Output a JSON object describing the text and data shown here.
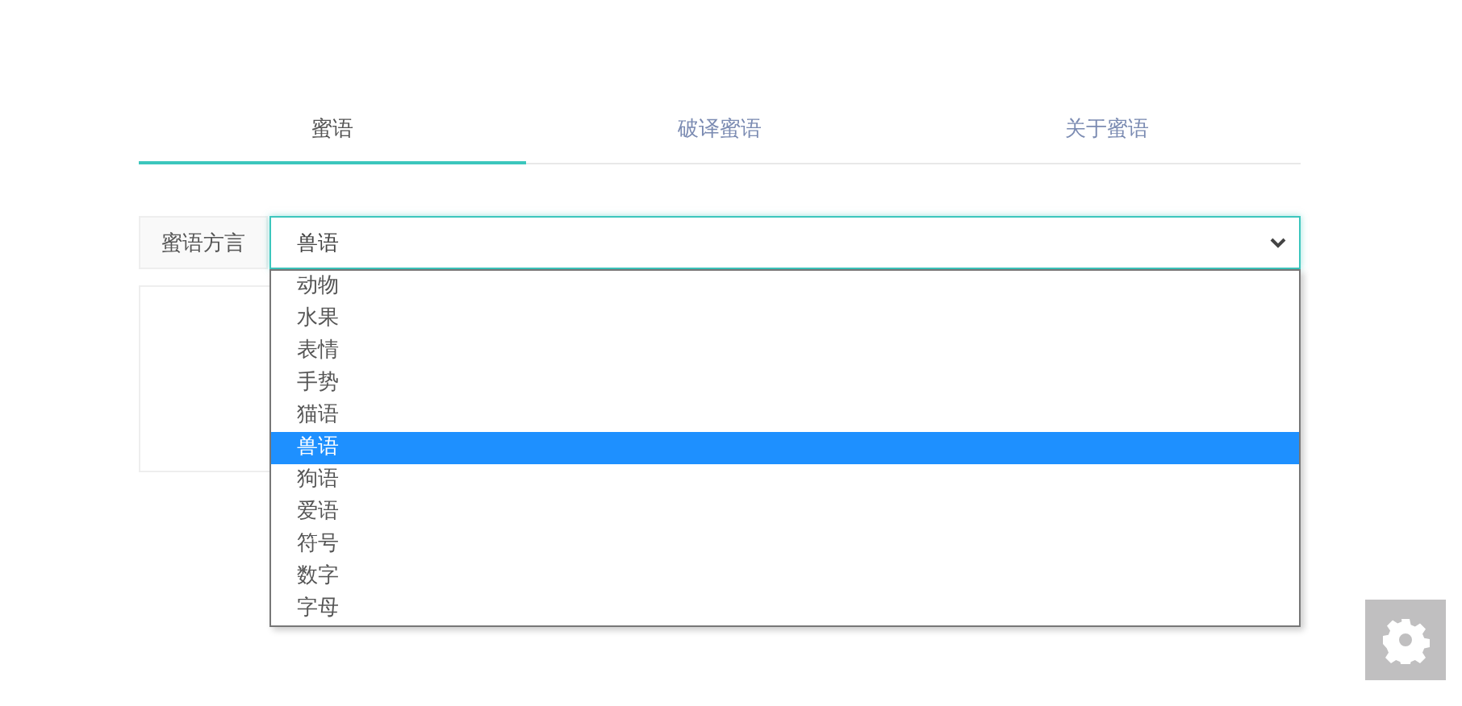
{
  "tabs": [
    {
      "label": "蜜语",
      "selected": true
    },
    {
      "label": "破译蜜语",
      "selected": false
    },
    {
      "label": "关于蜜语",
      "selected": false
    }
  ],
  "dialect": {
    "label": "蜜语方言",
    "value": "兽语",
    "expanded": true,
    "options": [
      {
        "label": "动物",
        "selected": false
      },
      {
        "label": "水果",
        "selected": false
      },
      {
        "label": "表情",
        "selected": false
      },
      {
        "label": "手势",
        "selected": false
      },
      {
        "label": "猫语",
        "selected": false
      },
      {
        "label": "兽语",
        "selected": true
      },
      {
        "label": "狗语",
        "selected": false
      },
      {
        "label": "爱语",
        "selected": false
      },
      {
        "label": "符号",
        "selected": false
      },
      {
        "label": "数字",
        "selected": false
      },
      {
        "label": "字母",
        "selected": false
      }
    ]
  }
}
